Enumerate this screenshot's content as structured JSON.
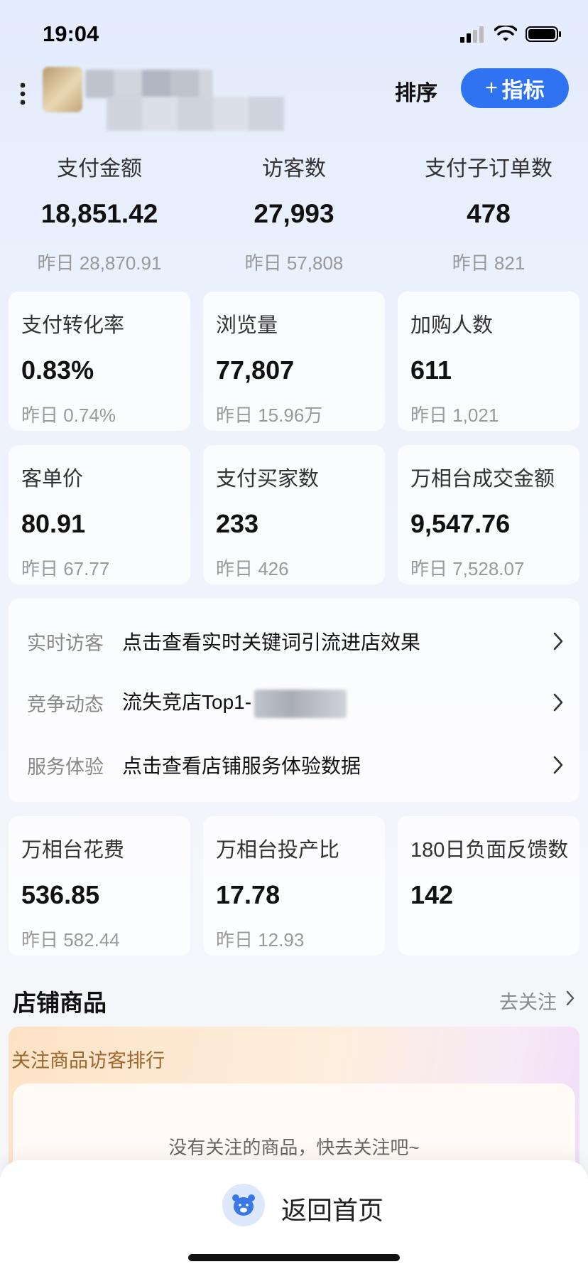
{
  "status_bar": {
    "time": "19:04"
  },
  "header": {
    "sort_label": "排序",
    "add_metric_label": "指标",
    "add_metric_icon": "plus-icon"
  },
  "top_metrics": [
    {
      "label": "支付金额",
      "value": "18,851.42",
      "prev": "昨日 28,870.91"
    },
    {
      "label": "访客数",
      "value": "27,993",
      "prev": "昨日 57,808"
    },
    {
      "label": "支付子订单数",
      "value": "478",
      "prev": "昨日 821"
    }
  ],
  "cards": [
    {
      "label": "支付转化率",
      "value": "0.83%",
      "prev": "昨日 0.74%"
    },
    {
      "label": "浏览量",
      "value": "77,807",
      "prev": "昨日 15.96万"
    },
    {
      "label": "加购人数",
      "value": "611",
      "prev": "昨日 1,021"
    },
    {
      "label": "客单价",
      "value": "80.91",
      "prev": "昨日 67.77"
    },
    {
      "label": "支付买家数",
      "value": "233",
      "prev": "昨日 426"
    },
    {
      "label": "万相台成交金额",
      "value": "9,547.76",
      "prev": "昨日 7,528.07"
    }
  ],
  "info_rows": [
    {
      "key": "实时访客",
      "value": "点击查看实时关键词引流进店效果"
    },
    {
      "key": "竞争动态",
      "value": "流失竞店Top1-"
    },
    {
      "key": "服务体验",
      "value": "点击查看店铺服务体验数据"
    }
  ],
  "cards2": [
    {
      "label": "万相台花费",
      "value": "536.85",
      "prev": "昨日 582.44"
    },
    {
      "label": "万相台投产比",
      "value": "17.78",
      "prev": "昨日 12.93"
    },
    {
      "label": "180日负面反馈数",
      "value": "142",
      "prev": ""
    }
  ],
  "store_products": {
    "title": "店铺商品",
    "follow_link": "去关注",
    "panel_title": "关注商品访客排行",
    "empty_text": "没有关注的商品，快去关注吧~"
  },
  "bottom_bar": {
    "label": "返回首页",
    "icon": "bear-mascot-icon"
  },
  "colors": {
    "accent": "#2f72f2"
  }
}
